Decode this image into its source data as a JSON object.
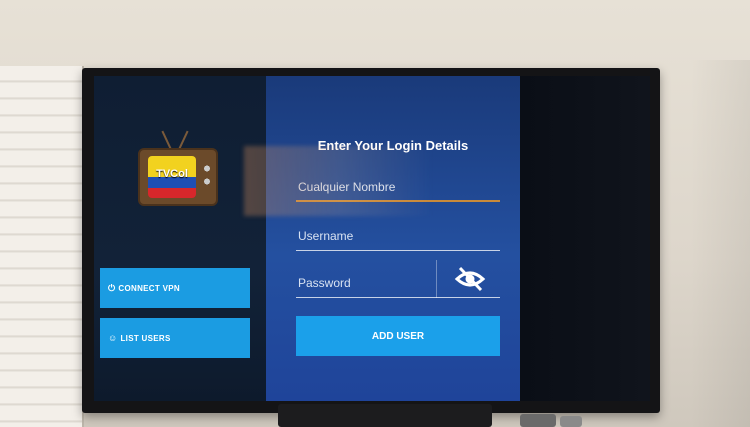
{
  "logo": {
    "brand": "TVCol"
  },
  "sidebar": {
    "connect_vpn": "CONNECT VPN",
    "list_users": "LIST USERS"
  },
  "login": {
    "title": "Enter Your Login Details",
    "name_placeholder": "Cualquier Nombre",
    "username_placeholder": "Username",
    "password_placeholder": "Password",
    "add_user": "ADD USER"
  },
  "icons": {
    "vpn": "power-icon",
    "users": "users-icon",
    "password_toggle": "eye-off-icon"
  },
  "colors": {
    "accent_button": "#1ba0ea",
    "panel": "#2450a0"
  }
}
